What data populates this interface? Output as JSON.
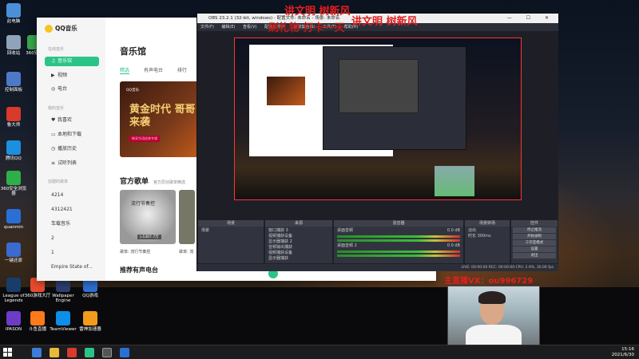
{
  "desktop": {
    "icons": [
      {
        "label": "此电脑",
        "color": "#4a90d9"
      },
      {
        "label": "回收站",
        "color": "#8fa4b8"
      },
      {
        "label": "360安全",
        "color": "#3aa64a"
      },
      {
        "label": "控制面板",
        "color": "#4d7ac7"
      },
      {
        "label": "鲁大师",
        "color": "#d83a2c"
      },
      {
        "label": "腾讯QQ",
        "color": "#1d8fe0"
      },
      {
        "label": "360安全浏览器",
        "color": "#2db04a"
      },
      {
        "label": "quanmin",
        "color": "#2a6fd6"
      },
      {
        "label": "一键还原",
        "color": "#3b6ad0"
      },
      {
        "label": "League of Legends",
        "color": "#1a3c6a"
      },
      {
        "label": "360游戏大厅",
        "color": "#e84b2e"
      },
      {
        "label": "Wallpaper Engine",
        "color": "#2c3f6e"
      },
      {
        "label": "QQ游戏",
        "color": "#2f6fd4"
      },
      {
        "label": "IPASON",
        "color": "#6d3cc7"
      },
      {
        "label": "斗鱼直播",
        "color": "#ff7a1a"
      },
      {
        "label": "TeamViewer",
        "color": "#0e8ee9"
      },
      {
        "label": "雷神加速器",
        "color": "#f29b1c"
      }
    ]
  },
  "qq_music": {
    "app_name": "QQ音乐",
    "sidebar": {
      "online_section": "在线音乐",
      "items": [
        {
          "icon": "♫",
          "label": "音乐馆"
        },
        {
          "icon": "▶",
          "label": "视频"
        },
        {
          "icon": "◎",
          "label": "电台"
        }
      ],
      "my_section": "我的音乐",
      "my_items": [
        {
          "icon": "♥",
          "label": "我喜欢"
        },
        {
          "icon": "▭",
          "label": "本地和下载"
        },
        {
          "icon": "◷",
          "label": "播放历史"
        },
        {
          "icon": "≡",
          "label": "试听列表"
        }
      ],
      "created_section": "创建的歌单",
      "playlists": [
        "4214",
        "4312421",
        "车载音乐",
        "2",
        "1",
        "Empire State of..."
      ]
    },
    "page_title": "音乐馆",
    "tabs": [
      "精选",
      "有声电台",
      "排行"
    ],
    "banner": {
      "brand": "QQ音乐",
      "title": "黄金时代 哥哥来袭",
      "tag": "畅享华语经典专辑"
    },
    "section_title": "官方歌单",
    "section_sub": "官方原创歌单精选",
    "card": {
      "title": "流行节奏控",
      "count": "▷1307.7万",
      "caption": "歌单: 流行节奏控",
      "caption2": "歌单: 流"
    },
    "section2_title": "推荐有声电台"
  },
  "obs": {
    "title": "OBS 23.2.1 (32-bit, windows) - 配置文件: 未命名 - 场景: 未命名",
    "menu": [
      "文件(F)",
      "编辑(E)",
      "查看(V)",
      "配置文件(P)",
      "场景集合(S)",
      "工具(T)",
      "帮助(H)"
    ],
    "docks": {
      "scenes": {
        "title": "场景",
        "item": "场景"
      },
      "sources": {
        "title": "来源",
        "items": [
          "窗口捕获 3",
          "视频捕获设备",
          "显示器捕获 2",
          "音频输出捕获",
          "视频捕获设备",
          "显示器捕获"
        ]
      },
      "mixer": {
        "title": "混音器",
        "ch1": "桌面音频",
        "db1": "0.0 dB",
        "ch2": "桌面音频 2",
        "db2": "0.0 dB"
      },
      "transitions": {
        "title": "场景转场",
        "type": "淡出",
        "duration_label": "时长",
        "duration": "300ms"
      },
      "controls": {
        "title": "控件",
        "buttons": [
          "停止推流",
          "开始录制",
          "工作室模式",
          "设置",
          "退出"
        ]
      }
    },
    "status": "LIVE: 00:00:00   REC: 00:00:00   CPU: 2.9%, 30.00 fps"
  },
  "overlays": {
    "line1": "讲文明 树新风",
    "line2": "讲文明 树新风",
    "line3": "刷礼物  打卡一天",
    "wechat": "主直播VX：ou996729"
  },
  "taskbar": {
    "time": "15:16",
    "date": "2021/6/30"
  }
}
